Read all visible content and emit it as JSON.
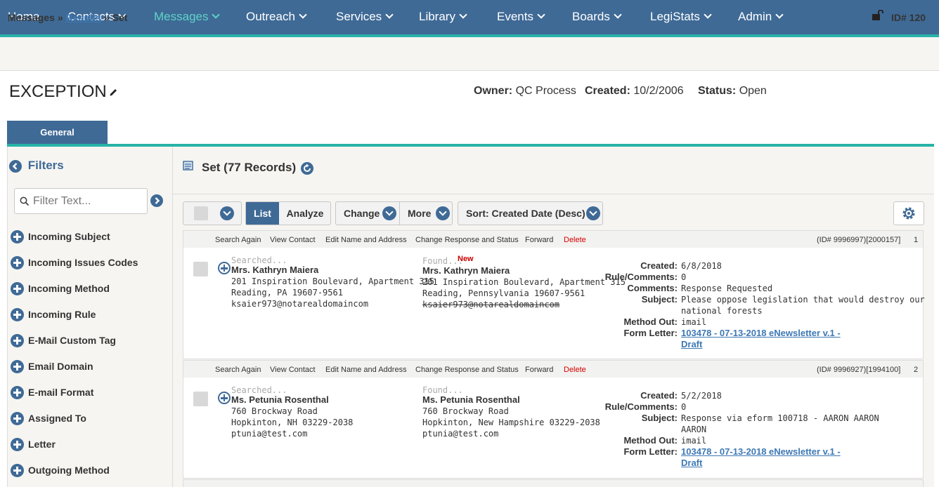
{
  "nav": {
    "items": [
      {
        "label": "Home",
        "dropdown": false
      },
      {
        "label": "Contacts",
        "dropdown": true
      },
      {
        "label": "Messages",
        "dropdown": true,
        "active": true
      },
      {
        "label": "Outreach",
        "dropdown": true
      },
      {
        "label": "Services",
        "dropdown": true
      },
      {
        "label": "Library",
        "dropdown": true
      },
      {
        "label": "Events",
        "dropdown": true
      },
      {
        "label": "Boards",
        "dropdown": true
      },
      {
        "label": "LegiStats",
        "dropdown": true
      },
      {
        "label": "Admin",
        "dropdown": true
      }
    ]
  },
  "breadcrumb": {
    "root": "Messages",
    "sep1": "»",
    "link": "Results",
    "sep2": "»",
    "current": "Set"
  },
  "record_id": "ID# 120",
  "page": {
    "title": "EXCEPTION",
    "owner_label": "Owner:",
    "owner_value": "QC Process",
    "created_label": "Created:",
    "created_value": "10/2/2006",
    "status_label": "Status:",
    "status_value": "Open"
  },
  "tabs": {
    "general": "General"
  },
  "filters": {
    "heading": "Filters",
    "placeholder": "Filter Text...",
    "items": [
      "Incoming Subject",
      "Incoming Issues Codes",
      "Incoming Method",
      "Incoming Rule",
      "E-Mail Custom Tag",
      "Email Domain",
      "E-mail Format",
      "Assigned To",
      "Letter",
      "Outgoing Method"
    ]
  },
  "set": {
    "heading": "Set (77 Records)"
  },
  "toolbar": {
    "list": "List",
    "analyze": "Analyze",
    "change": "Change",
    "more": "More",
    "sort": "Sort: Created Date (Desc)"
  },
  "records": [
    {
      "actions": [
        "Search Again",
        "View Contact",
        "Edit Name and Address",
        "Change Response and Status",
        "Forward",
        "Delete"
      ],
      "id_text": "(ID# 9996997)[2000157]",
      "num": "1",
      "searched_label": "Searched...",
      "searched": {
        "name": "Mrs. Kathryn Maiera",
        "addr1": "201 Inspiration Boulevard, Apartment 315",
        "addr2": "Reading, PA 19607-9561",
        "email": "ksaier973@notarealdomaincom"
      },
      "found_label": "Found...",
      "new_badge": "New",
      "found": {
        "name": "Mrs. Kathryn Maiera",
        "addr1": "201 Inspiration Boulevard, Apartment 315",
        "addr2": "Reading, Pennsylvania 19607-9561",
        "email": "ksaier973@notarealdomaincom"
      },
      "details": {
        "created_label": "Created:",
        "created": "6/8/2018",
        "rule_label": "Rule/Comments:",
        "rule": "0",
        "comments_label": "Comments:",
        "comments": "Response Requested",
        "subject_label": "Subject:",
        "subject_1": "Please oppose legislation that would destroy our",
        "subject_2": "national forests",
        "method_label": "Method Out:",
        "method": "imail",
        "form_label": "Form Letter:",
        "form_1": "103478 - 07-13-2018 eNewsletter v.1 -",
        "form_2": "Draft"
      }
    },
    {
      "actions": [
        "Search Again",
        "View Contact",
        "Edit Name and Address",
        "Change Response and Status",
        "Forward",
        "Delete"
      ],
      "id_text": "(ID# 9996927)[1994100]",
      "num": "2",
      "searched_label": "Searched...",
      "searched": {
        "name": "Ms. Petunia Rosenthal",
        "addr1": "760 Brockway Road",
        "addr2": "Hopkinton, NH 03229-2038",
        "email": "ptunia@test.com"
      },
      "found_label": "Found...",
      "found": {
        "name": "Ms. Petunia Rosenthal",
        "addr1": "760 Brockway Road",
        "addr2": "Hopkinton, New Hampshire 03229-2038",
        "email": "ptunia@test.com"
      },
      "details": {
        "created_label": "Created:",
        "created": "5/2/2018",
        "rule_label": "Rule/Comments:",
        "rule": "0",
        "subject_label": "Subject:",
        "subject_1": "Response via eform 100718 - AARON AARON",
        "subject_2": "AARON",
        "method_label": "Method Out:",
        "method": "imail",
        "form_label": "Form Letter:",
        "form_1": "103478 - 07-13-2018 eNewsletter v.1 -",
        "form_2": "Draft"
      }
    }
  ],
  "colors": {
    "nav_bg": "#3f6a96",
    "accent_teal": "#28b3a8",
    "active_nav": "#5fd3c6",
    "link": "#3d78b4",
    "delete": "#d40000"
  }
}
